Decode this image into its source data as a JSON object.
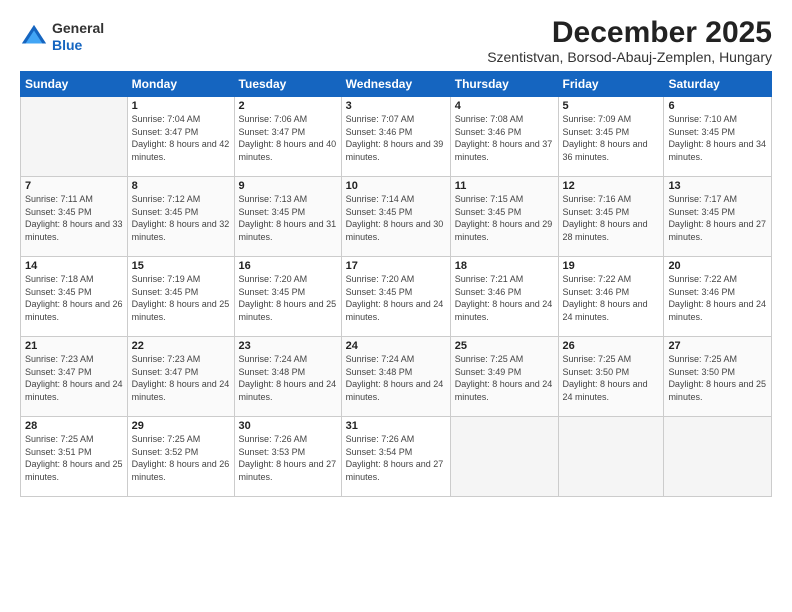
{
  "header": {
    "logo_general": "General",
    "logo_blue": "Blue",
    "month_year": "December 2025",
    "location": "Szentistvan, Borsod-Abauj-Zemplen, Hungary"
  },
  "weekdays": [
    "Sunday",
    "Monday",
    "Tuesday",
    "Wednesday",
    "Thursday",
    "Friday",
    "Saturday"
  ],
  "weeks": [
    [
      {
        "day": "",
        "sunrise": "",
        "sunset": "",
        "daylight": ""
      },
      {
        "day": "1",
        "sunrise": "Sunrise: 7:04 AM",
        "sunset": "Sunset: 3:47 PM",
        "daylight": "Daylight: 8 hours and 42 minutes."
      },
      {
        "day": "2",
        "sunrise": "Sunrise: 7:06 AM",
        "sunset": "Sunset: 3:47 PM",
        "daylight": "Daylight: 8 hours and 40 minutes."
      },
      {
        "day": "3",
        "sunrise": "Sunrise: 7:07 AM",
        "sunset": "Sunset: 3:46 PM",
        "daylight": "Daylight: 8 hours and 39 minutes."
      },
      {
        "day": "4",
        "sunrise": "Sunrise: 7:08 AM",
        "sunset": "Sunset: 3:46 PM",
        "daylight": "Daylight: 8 hours and 37 minutes."
      },
      {
        "day": "5",
        "sunrise": "Sunrise: 7:09 AM",
        "sunset": "Sunset: 3:45 PM",
        "daylight": "Daylight: 8 hours and 36 minutes."
      },
      {
        "day": "6",
        "sunrise": "Sunrise: 7:10 AM",
        "sunset": "Sunset: 3:45 PM",
        "daylight": "Daylight: 8 hours and 34 minutes."
      }
    ],
    [
      {
        "day": "7",
        "sunrise": "Sunrise: 7:11 AM",
        "sunset": "Sunset: 3:45 PM",
        "daylight": "Daylight: 8 hours and 33 minutes."
      },
      {
        "day": "8",
        "sunrise": "Sunrise: 7:12 AM",
        "sunset": "Sunset: 3:45 PM",
        "daylight": "Daylight: 8 hours and 32 minutes."
      },
      {
        "day": "9",
        "sunrise": "Sunrise: 7:13 AM",
        "sunset": "Sunset: 3:45 PM",
        "daylight": "Daylight: 8 hours and 31 minutes."
      },
      {
        "day": "10",
        "sunrise": "Sunrise: 7:14 AM",
        "sunset": "Sunset: 3:45 PM",
        "daylight": "Daylight: 8 hours and 30 minutes."
      },
      {
        "day": "11",
        "sunrise": "Sunrise: 7:15 AM",
        "sunset": "Sunset: 3:45 PM",
        "daylight": "Daylight: 8 hours and 29 minutes."
      },
      {
        "day": "12",
        "sunrise": "Sunrise: 7:16 AM",
        "sunset": "Sunset: 3:45 PM",
        "daylight": "Daylight: 8 hours and 28 minutes."
      },
      {
        "day": "13",
        "sunrise": "Sunrise: 7:17 AM",
        "sunset": "Sunset: 3:45 PM",
        "daylight": "Daylight: 8 hours and 27 minutes."
      }
    ],
    [
      {
        "day": "14",
        "sunrise": "Sunrise: 7:18 AM",
        "sunset": "Sunset: 3:45 PM",
        "daylight": "Daylight: 8 hours and 26 minutes."
      },
      {
        "day": "15",
        "sunrise": "Sunrise: 7:19 AM",
        "sunset": "Sunset: 3:45 PM",
        "daylight": "Daylight: 8 hours and 25 minutes."
      },
      {
        "day": "16",
        "sunrise": "Sunrise: 7:20 AM",
        "sunset": "Sunset: 3:45 PM",
        "daylight": "Daylight: 8 hours and 25 minutes."
      },
      {
        "day": "17",
        "sunrise": "Sunrise: 7:20 AM",
        "sunset": "Sunset: 3:45 PM",
        "daylight": "Daylight: 8 hours and 24 minutes."
      },
      {
        "day": "18",
        "sunrise": "Sunrise: 7:21 AM",
        "sunset": "Sunset: 3:46 PM",
        "daylight": "Daylight: 8 hours and 24 minutes."
      },
      {
        "day": "19",
        "sunrise": "Sunrise: 7:22 AM",
        "sunset": "Sunset: 3:46 PM",
        "daylight": "Daylight: 8 hours and 24 minutes."
      },
      {
        "day": "20",
        "sunrise": "Sunrise: 7:22 AM",
        "sunset": "Sunset: 3:46 PM",
        "daylight": "Daylight: 8 hours and 24 minutes."
      }
    ],
    [
      {
        "day": "21",
        "sunrise": "Sunrise: 7:23 AM",
        "sunset": "Sunset: 3:47 PM",
        "daylight": "Daylight: 8 hours and 24 minutes."
      },
      {
        "day": "22",
        "sunrise": "Sunrise: 7:23 AM",
        "sunset": "Sunset: 3:47 PM",
        "daylight": "Daylight: 8 hours and 24 minutes."
      },
      {
        "day": "23",
        "sunrise": "Sunrise: 7:24 AM",
        "sunset": "Sunset: 3:48 PM",
        "daylight": "Daylight: 8 hours and 24 minutes."
      },
      {
        "day": "24",
        "sunrise": "Sunrise: 7:24 AM",
        "sunset": "Sunset: 3:48 PM",
        "daylight": "Daylight: 8 hours and 24 minutes."
      },
      {
        "day": "25",
        "sunrise": "Sunrise: 7:25 AM",
        "sunset": "Sunset: 3:49 PM",
        "daylight": "Daylight: 8 hours and 24 minutes."
      },
      {
        "day": "26",
        "sunrise": "Sunrise: 7:25 AM",
        "sunset": "Sunset: 3:50 PM",
        "daylight": "Daylight: 8 hours and 24 minutes."
      },
      {
        "day": "27",
        "sunrise": "Sunrise: 7:25 AM",
        "sunset": "Sunset: 3:50 PM",
        "daylight": "Daylight: 8 hours and 25 minutes."
      }
    ],
    [
      {
        "day": "28",
        "sunrise": "Sunrise: 7:25 AM",
        "sunset": "Sunset: 3:51 PM",
        "daylight": "Daylight: 8 hours and 25 minutes."
      },
      {
        "day": "29",
        "sunrise": "Sunrise: 7:25 AM",
        "sunset": "Sunset: 3:52 PM",
        "daylight": "Daylight: 8 hours and 26 minutes."
      },
      {
        "day": "30",
        "sunrise": "Sunrise: 7:26 AM",
        "sunset": "Sunset: 3:53 PM",
        "daylight": "Daylight: 8 hours and 27 minutes."
      },
      {
        "day": "31",
        "sunrise": "Sunrise: 7:26 AM",
        "sunset": "Sunset: 3:54 PM",
        "daylight": "Daylight: 8 hours and 27 minutes."
      },
      {
        "day": "",
        "sunrise": "",
        "sunset": "",
        "daylight": ""
      },
      {
        "day": "",
        "sunrise": "",
        "sunset": "",
        "daylight": ""
      },
      {
        "day": "",
        "sunrise": "",
        "sunset": "",
        "daylight": ""
      }
    ]
  ]
}
